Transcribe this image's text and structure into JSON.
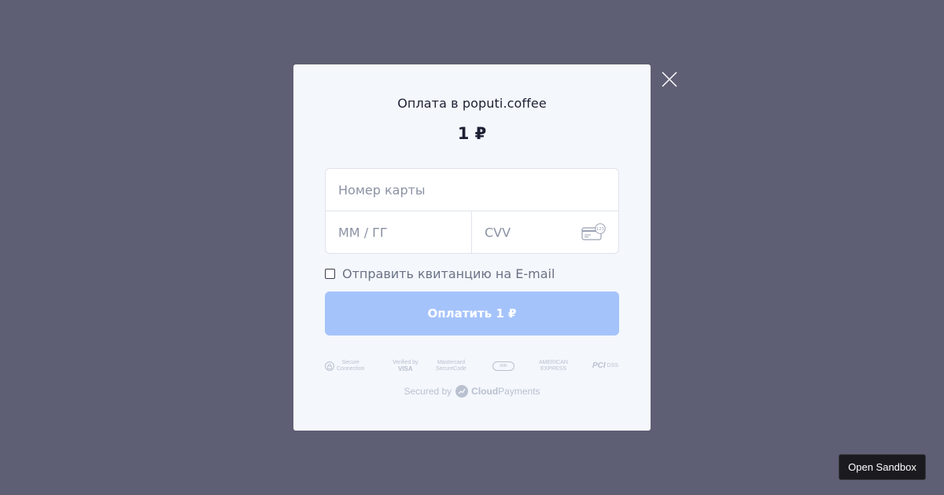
{
  "modal": {
    "title": "Оплата в poputi.coffee",
    "amount": "1 ₽"
  },
  "form": {
    "card_number_placeholder": "Номер карты",
    "expiry_placeholder": "MM / ГГ",
    "cvv_placeholder": "CVV",
    "cvv_icon_hint": "123",
    "receipt_label": "Отправить квитанцию на E-mail",
    "receipt_checked": false,
    "pay_button_label": "Оплатить 1 ₽"
  },
  "security_badges": [
    {
      "icon": "lock-icon",
      "lines": [
        "Secure",
        "Connection"
      ]
    },
    {
      "icon": "visa-logo",
      "lines": [
        "Verified by",
        "VISA"
      ]
    },
    {
      "icon": "mastercard-logo",
      "lines": [
        "Mastercard",
        "SecureCode"
      ]
    },
    {
      "icon": "mir-logo",
      "lines": [
        "MIR",
        "ACCEPT"
      ]
    },
    {
      "icon": "amex-logo",
      "lines": [
        "AMERICAN",
        "EXPRESS"
      ]
    },
    {
      "icon": "pci-logo",
      "lines": [
        "PCI",
        "DSS"
      ]
    }
  ],
  "footer": {
    "secured_by": "Secured by",
    "brand_bold": "Cloud",
    "brand_rest": "Payments"
  },
  "sandbox_button_label": "Open Sandbox",
  "colors": {
    "backdrop": "#5e5f74",
    "modal_bg": "#f4f7fc",
    "pay_button": "#a5c3fb",
    "text_dark": "#1d2033",
    "placeholder": "#8b92a4",
    "muted": "#b9c0cf"
  }
}
